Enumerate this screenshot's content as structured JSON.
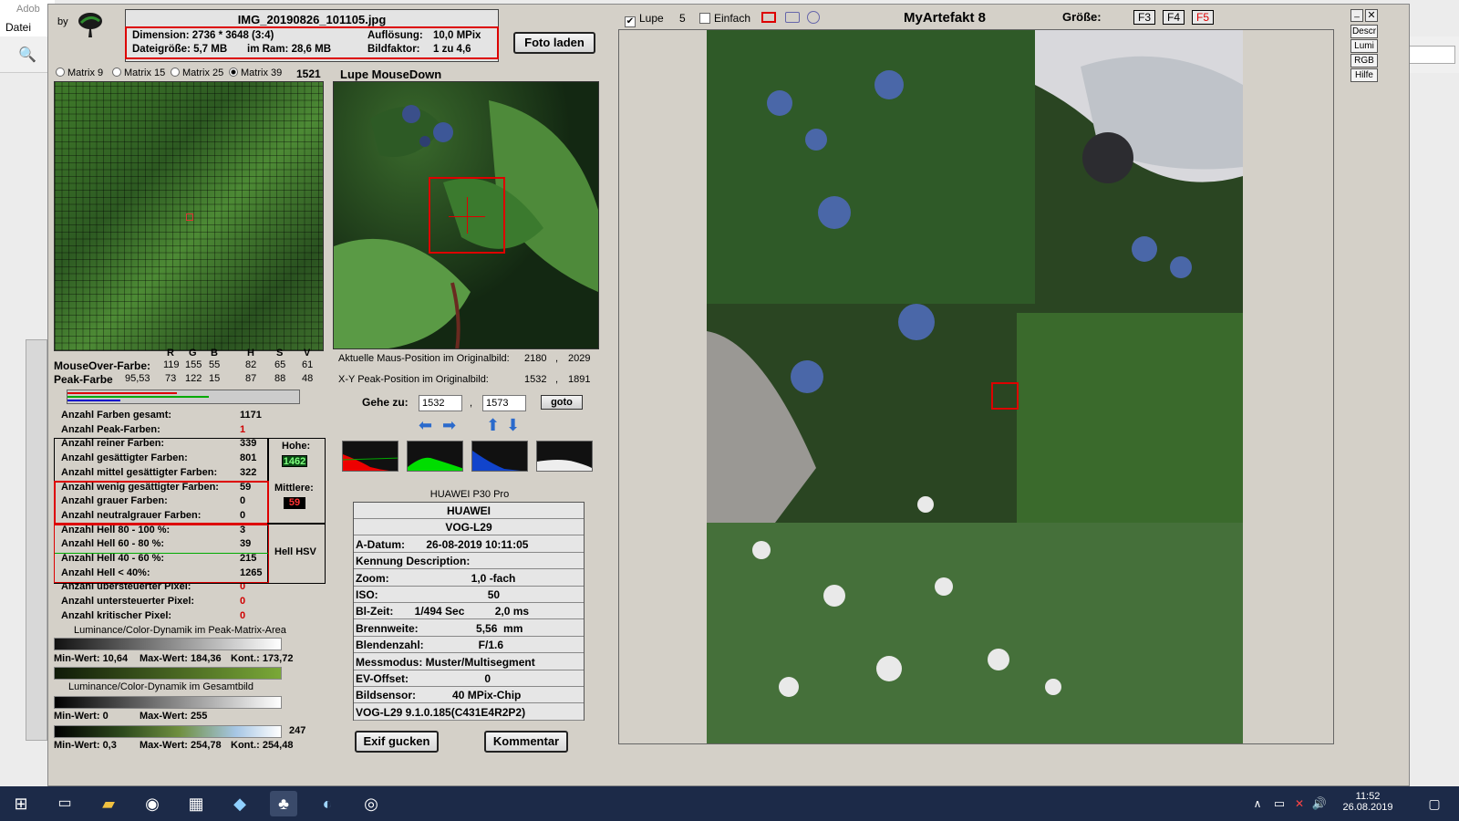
{
  "ps": {
    "title": "Adob",
    "menu": "Datei"
  },
  "header": {
    "by": "by",
    "filename": "IMG_20190826_101105.jpg",
    "dim_label": "Dimension: 2736 * 3648 (3:4)",
    "res_label": "Auflösung:",
    "res_value": "10,0 MPix",
    "size_label": "Dateigröße: 5,7 MB",
    "ram_label": "im Ram: 28,6 MB",
    "factor_label": "Bildfaktor:",
    "factor_value": "1 zu 4,6",
    "load_button": "Foto laden"
  },
  "top_controls": {
    "lupe": "Lupe",
    "lupe_num": "5",
    "einfach": "Einfach",
    "title": "MyArtefakt 8",
    "size_label": "Größe:",
    "f3": "F3",
    "f4": "F4",
    "f5": "F5"
  },
  "side_buttons": [
    "Descr",
    "Lumi",
    "RGB",
    "Hilfe"
  ],
  "matrix": {
    "m9": "Matrix 9",
    "m15": "Matrix 15",
    "m25": "Matrix 25",
    "m39": "Matrix 39",
    "count": "1521",
    "lupe_mode": "Lupe MouseDown"
  },
  "colors": {
    "h_r": "R",
    "h_g": "G",
    "h_b": "B",
    "h_h": "H",
    "h_s": "S",
    "h_v": "V",
    "mo_label": "MouseOver-Farbe:",
    "mo_r": "119",
    "mo_g": "155",
    "mo_b": "55",
    "mo_h": "82",
    "mo_s": "65",
    "mo_v": "61",
    "pk_label": "Peak-Farbe",
    "pk_pct": "95,53",
    "pk_r": "73",
    "pk_g": "122",
    "pk_b": "15",
    "pk_h": "87",
    "pk_s": "88",
    "pk_v": "48"
  },
  "stats": [
    {
      "label": "Anzahl Farben gesamt:",
      "value": "1171"
    },
    {
      "label": "Anzahl Peak-Farben:",
      "value": "1"
    },
    {
      "label": "Anzahl reiner Farben:",
      "value": "339"
    },
    {
      "label": "Anzahl gesättigter Farben:",
      "value": "801"
    },
    {
      "label": "Anzahl mittel gesättigter Farben:",
      "value": "322"
    },
    {
      "label": "Anzahl wenig gesättigter Farben:",
      "value": "59"
    },
    {
      "label": "Anzahl grauer Farben:",
      "value": "0"
    },
    {
      "label": "Anzahl neutralgrauer Farben:",
      "value": "0"
    },
    {
      "label": "Anzahl Hell 80 - 100 %:",
      "value": "3"
    },
    {
      "label": "Anzahl Hell 60 - 80 %:",
      "value": "39"
    },
    {
      "label": "Anzahl Hell 40 - 60 %:",
      "value": "215"
    },
    {
      "label": "Anzahl Hell < 40%:",
      "value": "1265"
    },
    {
      "label": "Anzahl übersteuerter Pixel:",
      "value": "0"
    },
    {
      "label": "Anzahl untersteuerter Pixel:",
      "value": "0"
    },
    {
      "label": "Anzahl kritischer Pixel:",
      "value": "0"
    }
  ],
  "side_stats": {
    "hohe": "Hohe:",
    "hohe_val": "1462",
    "mittlere": "Mittlere:",
    "mittlere_val": "59",
    "hell": "Hell HSV"
  },
  "dynamics": {
    "peak_title": "Luminance/Color-Dynamik im Peak-Matrix-Area",
    "peak_min": "Min-Wert: 10,64",
    "peak_max": "Max-Wert: 184,36",
    "peak_kont": "Kont.: 173,72",
    "total_title": "Luminance/Color-Dynamik im Gesamtbild",
    "total_min": "Min-Wert: 0",
    "total_max": "Max-Wert: 255",
    "third_num": "247",
    "third_min": "Min-Wert: 0,3",
    "third_max": "Max-Wert: 254,78",
    "third_kont": "Kont.: 254,48"
  },
  "position": {
    "mouse_label": "Aktuelle Maus-Position  im Originalbild:",
    "mouse_x": "2180",
    "mouse_y": "2029",
    "peak_label": "X-Y Peak-Position  im Originalbild:",
    "peak_x": "1532",
    "peak_y": "1891",
    "goto_label": "Gehe zu:",
    "goto_x": "1532",
    "goto_y": "1573",
    "goto_button": "goto",
    "sep": ","
  },
  "exif": {
    "camera": "HUAWEI P30 Pro",
    "rows": [
      "HUAWEI",
      "VOG-L29",
      "A-Datum:       26-08-2019 10:11:05",
      "Kennung Description:",
      "Zoom:                           1,0 -fach",
      "ISO:                                    50",
      "Bl-Zeit:       1/494 Sec          2,0 ms",
      "Brennweite:                   5,56  mm",
      "Blendenzahl:                  F/1.6",
      "Messmodus: Muster/Multisegment",
      "EV-Offset:                         0",
      "Bildsensor:            40 MPix-Chip",
      "VOG-L29 9.1.0.185(C431E4R2P2)"
    ],
    "exif_button": "Exif gucken",
    "comment_button": "Kommentar"
  },
  "taskbar": {
    "time": "11:52",
    "date": "26.08.2019"
  },
  "colors_ui": {
    "accent_red": "#d00000",
    "taskbar": "#1c2a48",
    "app_bg": "#d4d0c8"
  }
}
